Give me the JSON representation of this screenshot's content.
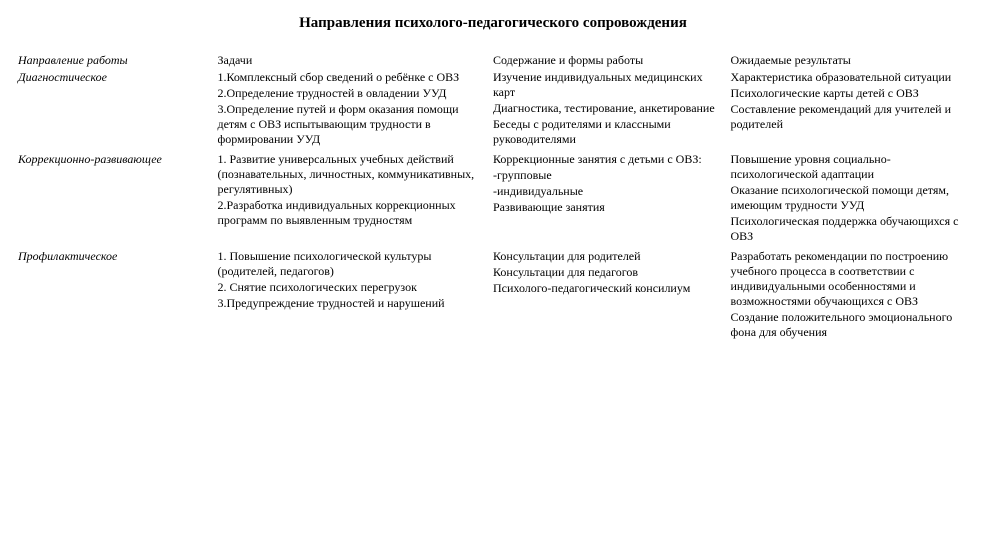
{
  "title": "Направления психолого-педагогического сопровождения",
  "columns": [
    "Направление работы",
    "Задачи",
    "Содержание и формы работы",
    "Ожидаемые результаты"
  ],
  "rows": [
    {
      "name": "Диагностическое",
      "tasks": [
        "1.Комплексный сбор сведений о ребёнке с ОВЗ",
        "2.Определение трудностей в овладении УУД",
        "3.Определение путей и форм оказания помощи детям с ОВЗ испытывающим трудности в формировании УУД"
      ],
      "content": [
        "Изучение индивидуальных медицинских карт",
        "Диагностика, тестирование, анкетирование",
        "Беседы с родителями и классными руководителями"
      ],
      "results": [
        "Характеристика образовательной ситуации",
        "Психологические карты детей с ОВЗ",
        "Составление рекомендаций для учителей и родителей"
      ]
    },
    {
      "name": "Коррекционно-развивающее",
      "tasks": [
        "1. Развитие универсальных учебных действий (познавательных, личностных, коммуникативных, регулятивных)",
        "2.Разработка индивидуальных коррекционных программ по выявленным трудностям"
      ],
      "content": [
        "Коррекционные занятия с детьми с ОВЗ:",
        "-групповые",
        "-индивидуальные",
        "Развивающие занятия"
      ],
      "results": [
        "Повышение уровня социально-психологической адаптации",
        "Оказание психологической помощи детям, имеющим трудности УУД",
        "Психологическая поддержка обучающихся с ОВЗ"
      ]
    },
    {
      "name": "Профилактическое",
      "tasks": [
        "1. Повышение психологической культуры (родителей, педагогов)",
        "2. Снятие психологических перегрузок",
        "3.Предупреждение трудностей и нарушений"
      ],
      "content": [
        "Консультации для родителей",
        "Консультации для педагогов",
        "Психолого-педагогический консилиум"
      ],
      "results": [
        "Разработать рекомендации по построению учебного процесса в соответствии с индивидуальными особенностями и возможностями обучающихся с ОВЗ",
        "Создание положительного эмоционального фона для обучения"
      ]
    }
  ]
}
